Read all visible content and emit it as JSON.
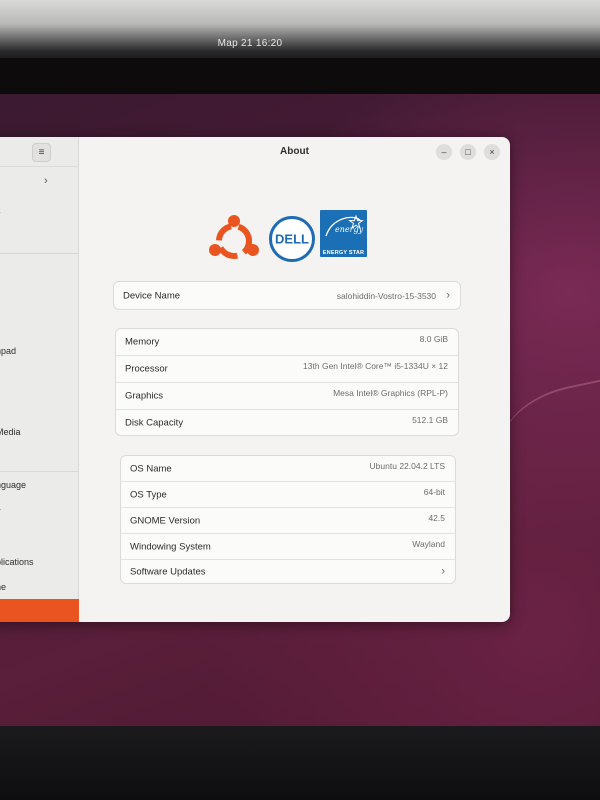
{
  "topbar": {
    "clock": "Map 21  16:20"
  },
  "window": {
    "title": "About",
    "buttons": {
      "minimize": "–",
      "maximize": "□",
      "close": "×"
    }
  },
  "sidebar": {
    "menu_icon": "≡",
    "items": [
      {
        "label": "s"
      },
      {
        "label": "hpad"
      },
      {
        "label": "Media"
      },
      {
        "label": "nguage"
      },
      {
        "label": "y"
      },
      {
        "label": "plications"
      },
      {
        "label": "ne"
      }
    ],
    "chevron": "›"
  },
  "logos": {
    "ubuntu": "ubuntu-logo",
    "dell": "DELL",
    "energy_star": "ENERGY STAR",
    "energy_star_script": "energy"
  },
  "device": {
    "label": "Device Name",
    "value": "salohiddin-Vostro-15-3530",
    "chevron": "›"
  },
  "hardware": [
    {
      "label": "Memory",
      "value": "8.0 GiB"
    },
    {
      "label": "Processor",
      "value": "13th Gen Intel® Core™ i5-1334U × 12"
    },
    {
      "label": "Graphics",
      "value": "Mesa Intel® Graphics (RPL-P)"
    },
    {
      "label": "Disk Capacity",
      "value": "512.1 GB"
    }
  ],
  "software": [
    {
      "label": "OS Name",
      "value": "Ubuntu 22.04.2 LTS"
    },
    {
      "label": "OS Type",
      "value": "64-bit"
    },
    {
      "label": "GNOME Version",
      "value": "42.5"
    },
    {
      "label": "Windowing System",
      "value": "Wayland"
    },
    {
      "label": "Software Updates",
      "value": "",
      "chevron": "›"
    }
  ],
  "colors": {
    "accent": "#e95420",
    "ubuntu": "#e95420",
    "dell": "#1f6cb5",
    "energy_star": "#1a6fb5"
  }
}
